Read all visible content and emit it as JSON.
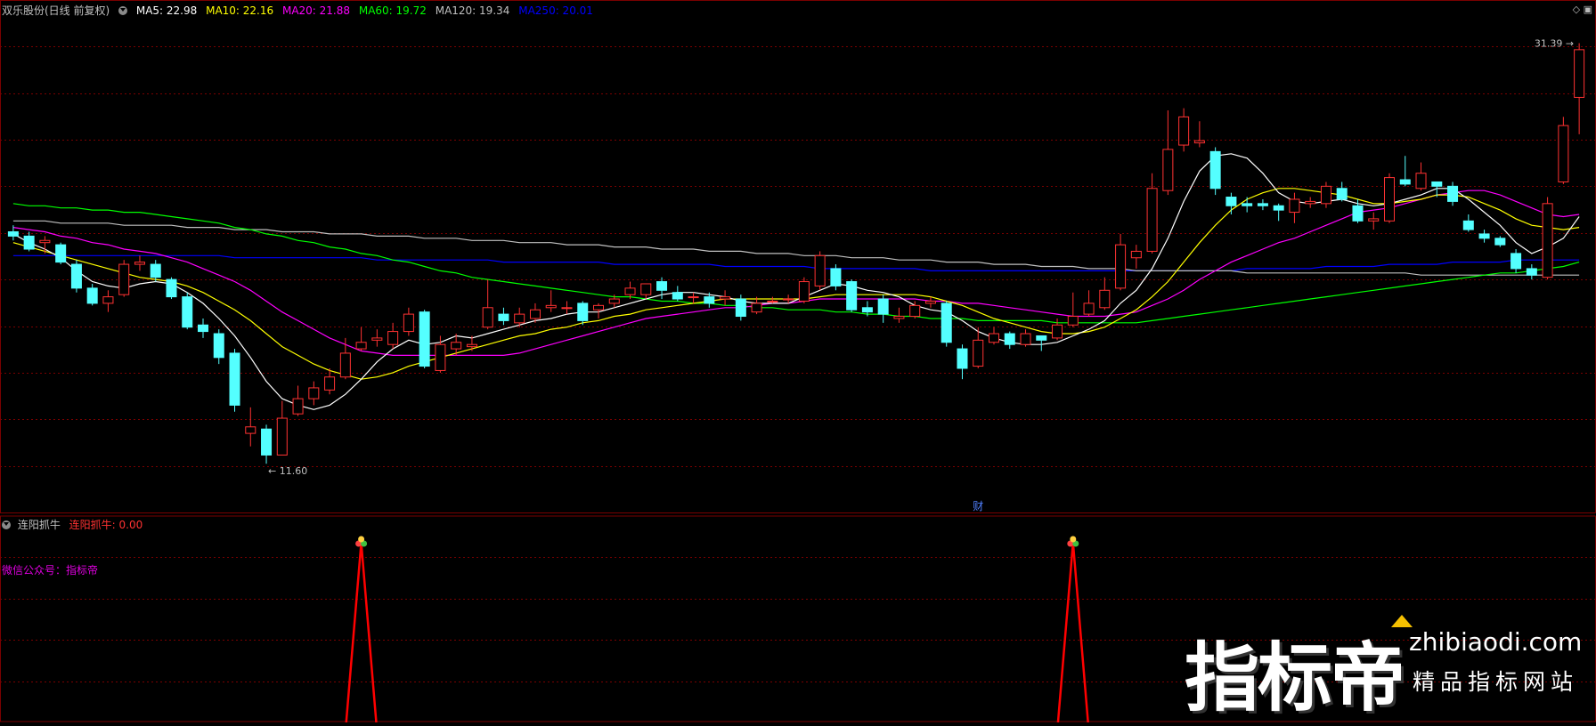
{
  "header": {
    "stock_name": "双乐股份(日线 前复权)",
    "ma": [
      {
        "label": "MA5: 22.98",
        "color": "#ffffff"
      },
      {
        "label": "MA10: 22.16",
        "color": "#ffff00"
      },
      {
        "label": "MA20: 21.88",
        "color": "#ff00ff"
      },
      {
        "label": "MA60: 19.72",
        "color": "#00ff00"
      },
      {
        "label": "MA120: 19.34",
        "color": "#c0c0c0"
      },
      {
        "label": "MA250: 20.01",
        "color": "#0000ff"
      }
    ]
  },
  "indicator": {
    "name": "连阳抓牛",
    "value_label": "连阳抓牛: 0.00",
    "wechat": "微信公众号：指标帝"
  },
  "annotations": {
    "low_label": "11.60",
    "high_label": "31.39",
    "finance_marker": "财"
  },
  "watermark": {
    "big": "指标帝",
    "url": "zhibiaodi.com",
    "sub": "精品指标网站"
  },
  "colors": {
    "up": "#ff3232",
    "down": "#54ffff",
    "grid": "#7a0000",
    "ma5": "#ffffff",
    "ma10": "#ffff00",
    "ma20": "#ff00ff",
    "ma60": "#00ff00",
    "ma120": "#c0c0c0",
    "ma250": "#0000ff",
    "signal": "#ff0000"
  },
  "chart_data": {
    "type": "candlestick",
    "ylim": [
      10.5,
      32.5
    ],
    "candles": [
      [
        22.3,
        22.1,
        22.6,
        21.9
      ],
      [
        22.1,
        21.5,
        22.3,
        21.4
      ],
      [
        21.8,
        21.9,
        22.1,
        21.3
      ],
      [
        21.7,
        20.9,
        21.8,
        20.8
      ],
      [
        20.8,
        19.7,
        21.0,
        19.5
      ],
      [
        19.7,
        19.0,
        19.9,
        18.9
      ],
      [
        19.0,
        19.3,
        19.6,
        18.6
      ],
      [
        19.4,
        20.8,
        21.0,
        19.3
      ],
      [
        20.8,
        20.9,
        21.2,
        20.5
      ],
      [
        20.8,
        20.2,
        21.0,
        20.0
      ],
      [
        20.1,
        19.3,
        20.2,
        19.2
      ],
      [
        19.3,
        17.9,
        19.5,
        17.8
      ],
      [
        18.0,
        17.7,
        18.3,
        17.4
      ],
      [
        17.6,
        16.5,
        17.8,
        16.2
      ],
      [
        16.7,
        14.3,
        16.9,
        14.0
      ],
      [
        13.0,
        13.3,
        14.2,
        12.4
      ],
      [
        13.2,
        12.0,
        13.4,
        11.6
      ],
      [
        12.0,
        13.7,
        14.5,
        12.0
      ],
      [
        13.9,
        14.6,
        15.2,
        13.8
      ],
      [
        14.6,
        15.1,
        15.4,
        14.3
      ],
      [
        15.0,
        15.6,
        16.0,
        14.8
      ],
      [
        15.6,
        16.7,
        17.4,
        15.5
      ],
      [
        16.9,
        17.2,
        17.9,
        16.8
      ],
      [
        17.3,
        17.4,
        17.8,
        17.0
      ],
      [
        17.1,
        17.7,
        18.1,
        16.9
      ],
      [
        17.7,
        18.5,
        18.8,
        17.5
      ],
      [
        18.6,
        16.1,
        18.7,
        16.0
      ],
      [
        15.9,
        17.1,
        17.5,
        15.8
      ],
      [
        16.9,
        17.2,
        17.6,
        16.6
      ],
      [
        17.0,
        17.1,
        17.5,
        16.8
      ],
      [
        17.9,
        18.8,
        20.1,
        17.8
      ],
      [
        18.5,
        18.2,
        18.8,
        18.0
      ],
      [
        18.1,
        18.5,
        18.8,
        17.9
      ],
      [
        18.3,
        18.7,
        19.0,
        18.1
      ],
      [
        18.8,
        18.9,
        19.6,
        18.6
      ],
      [
        18.8,
        18.8,
        19.1,
        18.5
      ],
      [
        19.0,
        18.2,
        19.1,
        18.0
      ],
      [
        18.7,
        18.9,
        19.0,
        18.3
      ],
      [
        19.0,
        19.2,
        19.4,
        18.8
      ],
      [
        19.4,
        19.7,
        20.0,
        19.2
      ],
      [
        19.4,
        19.9,
        19.9,
        19.2
      ],
      [
        20.0,
        19.6,
        20.2,
        19.2
      ],
      [
        19.5,
        19.2,
        19.8,
        19.1
      ],
      [
        19.3,
        19.3,
        19.5,
        19.0
      ],
      [
        19.3,
        19.0,
        19.5,
        18.8
      ],
      [
        19.2,
        19.3,
        19.6,
        18.9
      ],
      [
        19.2,
        18.4,
        19.4,
        18.2
      ],
      [
        18.6,
        19.0,
        19.3,
        18.5
      ],
      [
        19.1,
        19.1,
        19.3,
        19.0
      ],
      [
        19.2,
        19.2,
        19.4,
        19.0
      ],
      [
        19.1,
        20.0,
        20.2,
        19.0
      ],
      [
        19.8,
        21.2,
        21.4,
        19.6
      ],
      [
        20.6,
        19.8,
        20.8,
        19.6
      ],
      [
        20.0,
        18.7,
        20.1,
        18.6
      ],
      [
        18.8,
        18.6,
        19.1,
        18.4
      ],
      [
        19.2,
        18.5,
        19.4,
        18.1
      ],
      [
        18.3,
        18.4,
        18.8,
        18.1
      ],
      [
        18.4,
        18.9,
        19.1,
        18.3
      ],
      [
        19.0,
        19.1,
        19.3,
        18.8
      ],
      [
        19.0,
        17.2,
        19.1,
        17.0
      ],
      [
        16.9,
        16.0,
        17.1,
        15.5
      ],
      [
        16.1,
        17.3,
        17.9,
        16.0
      ],
      [
        17.2,
        17.6,
        17.9,
        17.1
      ],
      [
        17.6,
        17.1,
        17.7,
        16.9
      ],
      [
        17.1,
        17.6,
        17.8,
        17.0
      ],
      [
        17.5,
        17.3,
        17.5,
        16.8
      ],
      [
        17.4,
        18.0,
        18.3,
        17.3
      ],
      [
        18.0,
        18.4,
        19.5,
        17.9
      ],
      [
        18.5,
        19.0,
        19.6,
        18.4
      ],
      [
        18.8,
        19.6,
        20.2,
        18.7
      ],
      [
        19.7,
        21.7,
        22.2,
        19.6
      ],
      [
        21.1,
        21.4,
        21.7,
        20.6
      ],
      [
        21.4,
        24.3,
        25.0,
        21.3
      ],
      [
        24.2,
        26.1,
        27.9,
        24.0
      ],
      [
        26.3,
        27.6,
        28.0,
        26.0
      ],
      [
        26.4,
        26.5,
        27.4,
        26.2
      ],
      [
        26.0,
        24.3,
        26.2,
        24.0
      ],
      [
        23.9,
        23.5,
        24.1,
        23.1
      ],
      [
        23.6,
        23.5,
        23.9,
        23.2
      ],
      [
        23.6,
        23.5,
        23.8,
        23.3
      ],
      [
        23.5,
        23.3,
        23.6,
        22.8
      ],
      [
        23.2,
        23.8,
        24.1,
        22.7
      ],
      [
        23.6,
        23.7,
        23.9,
        23.4
      ],
      [
        23.6,
        24.4,
        24.6,
        23.4
      ],
      [
        24.3,
        23.8,
        24.6,
        23.7
      ],
      [
        23.5,
        22.8,
        23.8,
        22.7
      ],
      [
        22.8,
        22.9,
        23.2,
        22.4
      ],
      [
        22.8,
        24.8,
        25.0,
        22.7
      ],
      [
        24.7,
        24.5,
        25.8,
        24.4
      ],
      [
        24.3,
        25.0,
        25.5,
        24.2
      ],
      [
        24.6,
        24.4,
        24.6,
        23.9
      ],
      [
        24.4,
        23.7,
        24.6,
        23.5
      ],
      [
        22.8,
        22.4,
        23.1,
        22.3
      ],
      [
        22.2,
        22.0,
        22.4,
        21.8
      ],
      [
        22.0,
        21.7,
        22.1,
        21.6
      ],
      [
        21.3,
        20.6,
        21.5,
        20.4
      ],
      [
        20.6,
        20.3,
        20.8,
        20.1
      ],
      [
        20.2,
        23.6,
        23.9,
        20.1
      ],
      [
        24.6,
        27.2,
        27.6,
        24.5
      ],
      [
        28.5,
        30.7,
        31.0,
        26.8
      ]
    ],
    "ma5": [
      22.2,
      21.8,
      21.5,
      21.1,
      20.5,
      20.0,
      19.8,
      19.7,
      19.9,
      20.0,
      19.9,
      19.5,
      19.0,
      18.3,
      17.5,
      16.5,
      15.4,
      14.6,
      14.3,
      14.1,
      14.3,
      14.8,
      15.5,
      16.3,
      16.9,
      17.3,
      17.1,
      17.2,
      17.5,
      17.4,
      17.6,
      17.8,
      18.0,
      18.2,
      18.3,
      18.5,
      18.6,
      18.6,
      18.8,
      19.0,
      19.2,
      19.4,
      19.5,
      19.5,
      19.4,
      19.3,
      19.1,
      19.0,
      19.0,
      19.0,
      19.3,
      19.6,
      19.9,
      19.8,
      19.6,
      19.5,
      19.3,
      18.9,
      18.7,
      18.6,
      18.2,
      17.7,
      17.4,
      17.2,
      17.1,
      17.1,
      17.2,
      17.5,
      17.8,
      18.2,
      19.0,
      19.6,
      20.6,
      22.0,
      23.7,
      25.1,
      25.8,
      25.9,
      25.7,
      25.0,
      24.1,
      23.7,
      23.6,
      23.7,
      23.8,
      23.6,
      23.5,
      23.6,
      23.8,
      24.0,
      24.3,
      24.3,
      23.8,
      23.2,
      22.6,
      21.8,
      21.3,
      21.6,
      22.0,
      23.0
    ],
    "ma10": [
      21.8,
      21.6,
      21.4,
      21.2,
      21.0,
      20.8,
      20.6,
      20.4,
      20.2,
      20.1,
      20.0,
      19.8,
      19.5,
      19.1,
      18.7,
      18.2,
      17.6,
      17.0,
      16.6,
      16.2,
      15.9,
      15.7,
      15.5,
      15.6,
      15.8,
      16.1,
      16.3,
      16.5,
      16.7,
      16.9,
      17.1,
      17.3,
      17.5,
      17.6,
      17.8,
      17.9,
      18.1,
      18.2,
      18.4,
      18.5,
      18.7,
      18.8,
      18.9,
      19.0,
      19.1,
      19.2,
      19.2,
      19.2,
      19.2,
      19.2,
      19.2,
      19.3,
      19.4,
      19.4,
      19.4,
      19.4,
      19.4,
      19.4,
      19.3,
      19.1,
      18.9,
      18.6,
      18.3,
      18.1,
      17.9,
      17.7,
      17.6,
      17.6,
      17.7,
      17.9,
      18.3,
      18.7,
      19.3,
      20.0,
      20.9,
      21.8,
      22.6,
      23.3,
      23.8,
      24.1,
      24.3,
      24.3,
      24.2,
      24.1,
      24.0,
      23.8,
      23.6,
      23.6,
      23.7,
      23.8,
      24.0,
      24.0,
      23.9,
      23.6,
      23.3,
      22.9,
      22.6,
      22.5,
      22.4,
      22.5
    ],
    "ma20": [
      22.5,
      22.4,
      22.3,
      22.1,
      22.0,
      21.8,
      21.7,
      21.5,
      21.4,
      21.3,
      21.1,
      20.9,
      20.6,
      20.3,
      20.0,
      19.6,
      19.1,
      18.6,
      18.2,
      17.8,
      17.4,
      17.1,
      16.8,
      16.7,
      16.6,
      16.6,
      16.6,
      16.6,
      16.6,
      16.6,
      16.6,
      16.6,
      16.7,
      16.9,
      17.1,
      17.3,
      17.5,
      17.7,
      17.9,
      18.1,
      18.3,
      18.4,
      18.5,
      18.6,
      18.7,
      18.8,
      18.8,
      18.9,
      19.0,
      19.0,
      19.1,
      19.2,
      19.2,
      19.2,
      19.2,
      19.2,
      19.2,
      19.2,
      19.1,
      19.1,
      19.0,
      19.0,
      18.9,
      18.8,
      18.7,
      18.6,
      18.5,
      18.4,
      18.4,
      18.4,
      18.5,
      18.6,
      18.9,
      19.2,
      19.6,
      20.1,
      20.5,
      20.9,
      21.2,
      21.5,
      21.8,
      22.0,
      22.3,
      22.6,
      22.9,
      23.2,
      23.3,
      23.4,
      23.6,
      23.8,
      24.0,
      24.1,
      24.2,
      24.2,
      24.0,
      23.7,
      23.4,
      23.1,
      23.0,
      23.1
    ],
    "ma60": [
      23.6,
      23.5,
      23.5,
      23.4,
      23.4,
      23.3,
      23.3,
      23.2,
      23.2,
      23.1,
      23.0,
      22.9,
      22.8,
      22.7,
      22.5,
      22.4,
      22.2,
      22.1,
      21.9,
      21.8,
      21.6,
      21.5,
      21.3,
      21.2,
      21.0,
      20.9,
      20.7,
      20.5,
      20.4,
      20.2,
      20.1,
      20.0,
      19.9,
      19.8,
      19.7,
      19.6,
      19.5,
      19.4,
      19.3,
      19.3,
      19.2,
      19.1,
      19.1,
      19.0,
      19.0,
      18.9,
      18.9,
      18.8,
      18.8,
      18.7,
      18.7,
      18.7,
      18.6,
      18.6,
      18.5,
      18.5,
      18.4,
      18.4,
      18.3,
      18.3,
      18.3,
      18.2,
      18.2,
      18.2,
      18.2,
      18.2,
      18.1,
      18.1,
      18.1,
      18.1,
      18.1,
      18.1,
      18.2,
      18.3,
      18.4,
      18.5,
      18.6,
      18.7,
      18.8,
      18.9,
      19.0,
      19.1,
      19.2,
      19.3,
      19.4,
      19.5,
      19.6,
      19.7,
      19.8,
      19.9,
      20.0,
      20.1,
      20.2,
      20.3,
      20.4,
      20.4,
      20.5,
      20.6,
      20.7,
      20.9
    ],
    "ma120": [
      22.8,
      22.8,
      22.8,
      22.7,
      22.7,
      22.7,
      22.7,
      22.6,
      22.6,
      22.6,
      22.6,
      22.5,
      22.5,
      22.5,
      22.4,
      22.4,
      22.4,
      22.3,
      22.3,
      22.3,
      22.2,
      22.2,
      22.2,
      22.1,
      22.1,
      22.1,
      22.0,
      22.0,
      22.0,
      21.9,
      21.9,
      21.9,
      21.8,
      21.8,
      21.8,
      21.7,
      21.7,
      21.7,
      21.6,
      21.6,
      21.6,
      21.5,
      21.5,
      21.5,
      21.4,
      21.4,
      21.4,
      21.3,
      21.3,
      21.3,
      21.2,
      21.2,
      21.2,
      21.1,
      21.1,
      21.1,
      21.0,
      21.0,
      21.0,
      20.9,
      20.9,
      20.9,
      20.8,
      20.8,
      20.8,
      20.7,
      20.7,
      20.7,
      20.6,
      20.6,
      20.6,
      20.5,
      20.5,
      20.5,
      20.5,
      20.5,
      20.5,
      20.5,
      20.4,
      20.4,
      20.4,
      20.4,
      20.4,
      20.4,
      20.4,
      20.4,
      20.4,
      20.4,
      20.4,
      20.3,
      20.3,
      20.3,
      20.3,
      20.3,
      20.3,
      20.3,
      20.3,
      20.3,
      20.3,
      20.3
    ],
    "ma250": [
      21.2,
      21.2,
      21.2,
      21.2,
      21.2,
      21.2,
      21.2,
      21.2,
      21.2,
      21.2,
      21.2,
      21.2,
      21.2,
      21.2,
      21.1,
      21.1,
      21.1,
      21.1,
      21.1,
      21.1,
      21.1,
      21.1,
      21.1,
      21.0,
      21.0,
      21.0,
      21.0,
      21.0,
      21.0,
      21.0,
      21.0,
      20.9,
      20.9,
      20.9,
      20.9,
      20.9,
      20.9,
      20.9,
      20.8,
      20.8,
      20.8,
      20.8,
      20.8,
      20.8,
      20.8,
      20.7,
      20.7,
      20.7,
      20.7,
      20.7,
      20.7,
      20.6,
      20.6,
      20.6,
      20.6,
      20.6,
      20.6,
      20.6,
      20.5,
      20.5,
      20.5,
      20.5,
      20.5,
      20.5,
      20.5,
      20.5,
      20.5,
      20.5,
      20.5,
      20.5,
      20.5,
      20.5,
      20.5,
      20.5,
      20.5,
      20.5,
      20.5,
      20.5,
      20.6,
      20.6,
      20.6,
      20.6,
      20.6,
      20.7,
      20.7,
      20.7,
      20.7,
      20.8,
      20.8,
      20.8,
      20.8,
      20.9,
      20.9,
      20.9,
      20.9,
      21.0,
      21.0,
      21.0,
      21.0,
      21.0
    ],
    "signal_peaks": [
      22,
      67
    ],
    "signal_ylim": [
      0,
      1
    ]
  }
}
